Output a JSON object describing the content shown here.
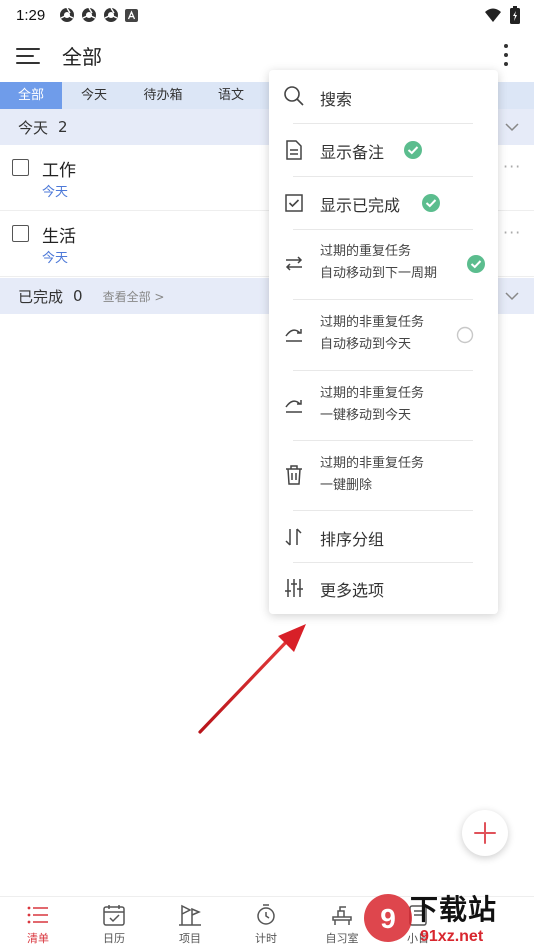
{
  "status_bar": {
    "time": "1:29",
    "icons": [
      "chrome-icon",
      "chrome-icon",
      "chrome-icon",
      "a-notification-icon"
    ],
    "right_icons": [
      "wifi-icon",
      "battery-icon"
    ]
  },
  "header": {
    "title": "全部",
    "menu_icon": "hamburger-menu-icon",
    "more_icon": "vertical-dots-icon"
  },
  "tabs": [
    {
      "label": "全部",
      "active": true
    },
    {
      "label": "今天",
      "active": false
    },
    {
      "label": "待办箱",
      "active": false
    },
    {
      "label": "语文",
      "active": false
    }
  ],
  "sections": {
    "today": {
      "title": "今天",
      "count": "2"
    },
    "completed": {
      "title": "已完成",
      "count": "0",
      "link": "查看全部 >"
    }
  },
  "tasks": [
    {
      "title": "工作",
      "date": "今天"
    },
    {
      "title": "生活",
      "date": "今天"
    }
  ],
  "popup_menu": {
    "search": "搜索",
    "show_notes": "显示备注",
    "show_completed": "显示已完成",
    "overdue_repeat": {
      "line1": "过期的重复任务",
      "line2": "自动移动到下一周期"
    },
    "overdue_nonrepeat_auto": {
      "line1": "过期的非重复任务",
      "line2": "自动移动到今天"
    },
    "overdue_nonrepeat_onekey": {
      "line1": "过期的非重复任务",
      "line2": "一键移动到今天"
    },
    "overdue_nonrepeat_delete": {
      "line1": "过期的非重复任务",
      "line2": "一键删除"
    },
    "sort_group": "排序分组",
    "more_options": "更多选项"
  },
  "bottom_nav": [
    {
      "label": "清单",
      "icon": "list-icon",
      "active": true
    },
    {
      "label": "日历",
      "icon": "calendar-icon",
      "active": false
    },
    {
      "label": "项目",
      "icon": "project-icon",
      "active": false
    },
    {
      "label": "计时",
      "icon": "timer-icon",
      "active": false
    },
    {
      "label": "自习室",
      "icon": "study-room-icon",
      "active": false
    },
    {
      "label": "小日",
      "icon": "diary-icon",
      "active": false
    }
  ],
  "watermark": {
    "big": "下载站",
    "small": "91xz.net"
  },
  "colors": {
    "accent_blue": "#6f9cea",
    "tab_bar_bg": "#dce6f6",
    "section_bg": "#e6ebf8",
    "check_green": "#5bbd8e",
    "active_nav_red": "#d9363e",
    "date_blue": "#4d79d8"
  }
}
